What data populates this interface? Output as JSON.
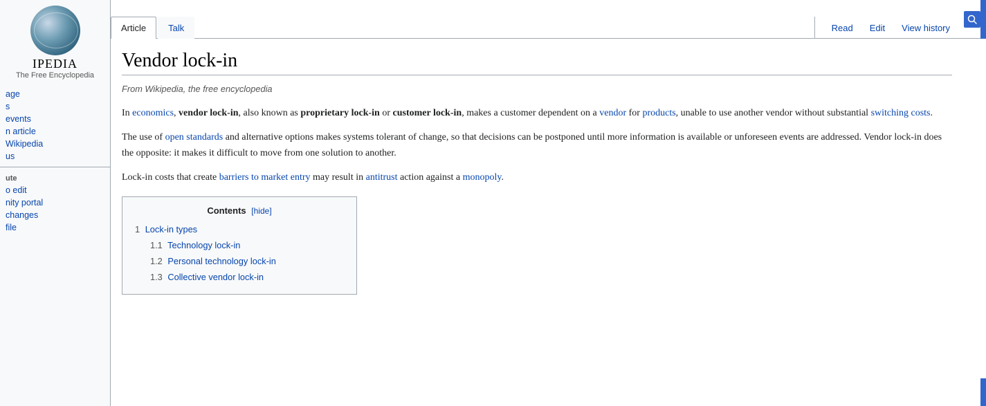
{
  "sidebar": {
    "logo_text": "IPEDIA",
    "logo_sub": "The Free Encyclopedia",
    "nav_items": [
      {
        "label": "age",
        "href": "#"
      },
      {
        "label": "s",
        "href": "#"
      },
      {
        "label": "events",
        "href": "#"
      },
      {
        "label": "n article",
        "href": "#"
      },
      {
        "label": "Wikipedia",
        "href": "#"
      },
      {
        "label": "us",
        "href": "#"
      }
    ],
    "tools_section": "ute",
    "tools_items": [
      {
        "label": "o edit",
        "href": "#"
      },
      {
        "label": "nity portal",
        "href": "#"
      },
      {
        "label": "changes",
        "href": "#"
      },
      {
        "label": "file",
        "href": "#"
      }
    ]
  },
  "tabs": {
    "article": "Article",
    "talk": "Talk",
    "read": "Read",
    "edit": "Edit",
    "view_history": "View history"
  },
  "article": {
    "title": "Vendor lock-in",
    "from": "From Wikipedia, the free encyclopedia",
    "para1": "In economics, vendor lock-in, also known as proprietary lock-in or customer lock-in, makes a customer dependent on a vendor for products, unable to use another vendor without substantial switching costs.",
    "para1_links": {
      "economics": "economics",
      "vendor": "vendor",
      "products": "products",
      "switching_costs": "switching costs"
    },
    "para2": "The use of open standards and alternative options makes systems tolerant of change, so that decisions can be postponed until more information is available or unforeseen events are addressed. Vendor lock-in does the opposite: it makes it difficult to move from one solution to another.",
    "para2_links": {
      "open_standards": "open standards"
    },
    "para3": "Lock-in costs that create barriers to market entry may result in antitrust action against a monopoly.",
    "para3_links": {
      "barriers": "barriers to market entry",
      "antitrust": "antitrust",
      "monopoly": "monopoly"
    },
    "toc": {
      "title": "Contents",
      "hide_label": "[hide]",
      "items": [
        {
          "number": "1",
          "label": "Lock-in types",
          "level": 1
        },
        {
          "number": "1.1",
          "label": "Technology lock-in",
          "level": 2
        },
        {
          "number": "1.2",
          "label": "Personal technology lock-in",
          "level": 2
        },
        {
          "number": "1.3",
          "label": "Collective vendor lock-in",
          "level": 2
        }
      ]
    }
  }
}
